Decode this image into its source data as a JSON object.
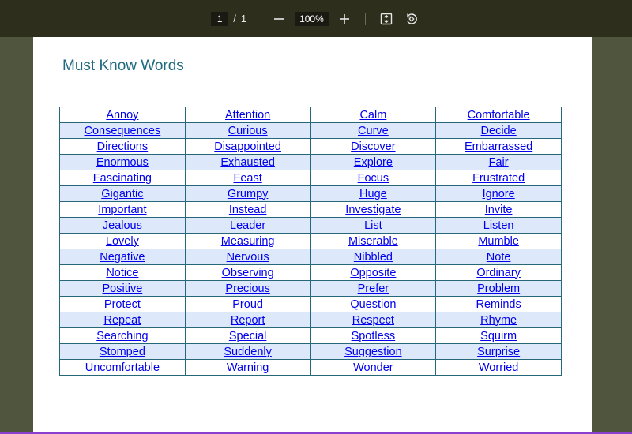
{
  "toolbar": {
    "current_page": "1",
    "page_separator": "/",
    "total_pages": "1",
    "zoom_out_icon": "minus-icon",
    "zoom_level": "100%",
    "zoom_in_icon": "plus-icon",
    "fit_icon": "fit-page-icon",
    "rotate_icon": "rotate-icon"
  },
  "document": {
    "title": "Must Know Words",
    "rows": [
      [
        "Annoy",
        "Attention",
        "Calm",
        "Comfortable"
      ],
      [
        "Consequences",
        "Curious",
        "Curve",
        "Decide"
      ],
      [
        "Directions",
        "Disappointed",
        "Discover",
        "Embarrassed"
      ],
      [
        "Enormous",
        "Exhausted",
        "Explore",
        "Fair"
      ],
      [
        "Fascinating",
        "Feast",
        "Focus",
        "Frustrated"
      ],
      [
        "Gigantic",
        "Grumpy",
        "Huge",
        "Ignore"
      ],
      [
        "Important",
        "Instead",
        "Investigate",
        "Invite"
      ],
      [
        "Jealous",
        "Leader",
        "List",
        "Listen"
      ],
      [
        "Lovely",
        "Measuring",
        "Miserable",
        "Mumble"
      ],
      [
        "Negative",
        "Nervous",
        "Nibbled",
        "Note"
      ],
      [
        "Notice",
        "Observing",
        "Opposite",
        "Ordinary"
      ],
      [
        "Positive",
        "Precious",
        "Prefer",
        "Problem"
      ],
      [
        "Protect",
        "Proud",
        "Question",
        "Reminds"
      ],
      [
        "Repeat",
        "Report",
        "Respect",
        "Rhyme"
      ],
      [
        "Searching",
        "Special",
        "Spotless",
        "Squirm"
      ],
      [
        "Stomped",
        "Suddenly",
        "Suggestion",
        "Surprise"
      ],
      [
        "Uncomfortable",
        "Warning",
        "Wonder",
        "Worried"
      ]
    ]
  },
  "colors": {
    "toolbar_bg": "#2d2e1c",
    "viewer_bg": "#50563e",
    "title_color": "#1f6a80",
    "link_color": "#0000ee",
    "row_alt_bg": "#dde8fb",
    "table_border": "#26687a"
  }
}
